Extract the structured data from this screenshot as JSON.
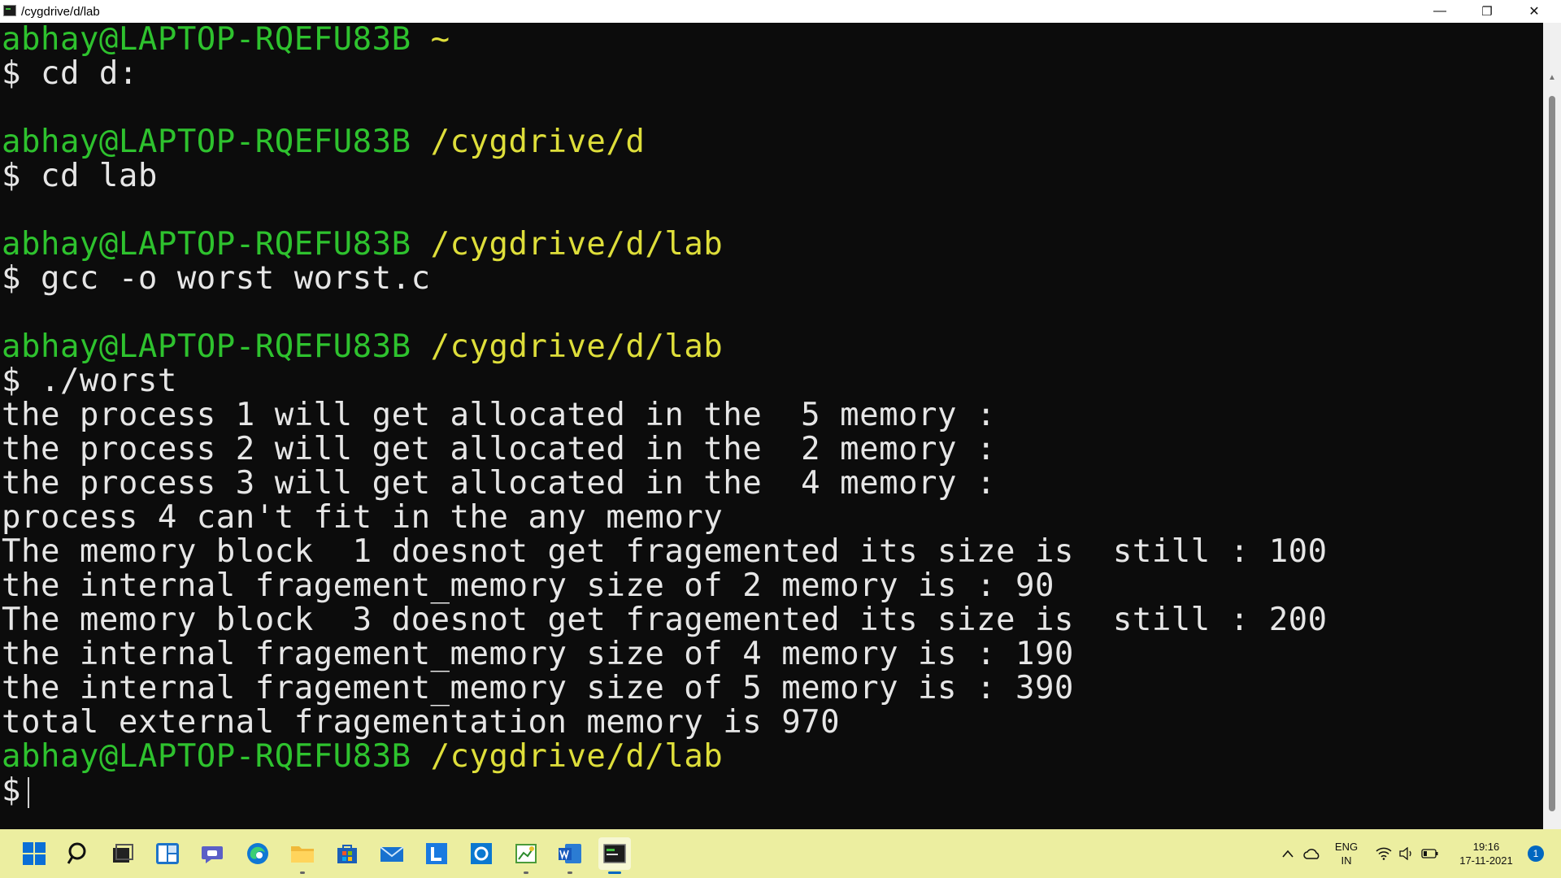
{
  "window": {
    "title": "/cygdrive/d/lab",
    "minimize_glyph": "—",
    "restore_glyph": "❐",
    "close_glyph": "✕"
  },
  "terminal": {
    "colors": {
      "user": "#2ec22e",
      "path": "#dede3a",
      "text": "#e6e6e6",
      "background": "#0c0c0c"
    },
    "lines": [
      {
        "user": "abhay@LAPTOP-RQEFU83B",
        "path": "~",
        "text": ""
      },
      {
        "user": "",
        "path": "",
        "text": "$ cd d:"
      },
      {
        "user": "",
        "path": "",
        "text": ""
      },
      {
        "user": "abhay@LAPTOP-RQEFU83B",
        "path": "/cygdrive/d",
        "text": ""
      },
      {
        "user": "",
        "path": "",
        "text": "$ cd lab"
      },
      {
        "user": "",
        "path": "",
        "text": ""
      },
      {
        "user": "abhay@LAPTOP-RQEFU83B",
        "path": "/cygdrive/d/lab",
        "text": ""
      },
      {
        "user": "",
        "path": "",
        "text": "$ gcc -o worst worst.c"
      },
      {
        "user": "",
        "path": "",
        "text": ""
      },
      {
        "user": "abhay@LAPTOP-RQEFU83B",
        "path": "/cygdrive/d/lab",
        "text": ""
      },
      {
        "user": "",
        "path": "",
        "text": "$ ./worst"
      },
      {
        "user": "",
        "path": "",
        "text": "the process 1 will get allocated in the  5 memory :"
      },
      {
        "user": "",
        "path": "",
        "text": "the process 2 will get allocated in the  2 memory :"
      },
      {
        "user": "",
        "path": "",
        "text": "the process 3 will get allocated in the  4 memory :"
      },
      {
        "user": "",
        "path": "",
        "text": "process 4 can't fit in the any memory"
      },
      {
        "user": "",
        "path": "",
        "text": "The memory block  1 doesnot get fragemented its size is  still : 100"
      },
      {
        "user": "",
        "path": "",
        "text": "the internal fragement_memory size of 2 memory is : 90"
      },
      {
        "user": "",
        "path": "",
        "text": "The memory block  3 doesnot get fragemented its size is  still : 200"
      },
      {
        "user": "",
        "path": "",
        "text": "the internal fragement_memory size of 4 memory is : 190"
      },
      {
        "user": "",
        "path": "",
        "text": "the internal fragement_memory size of 5 memory is : 390"
      },
      {
        "user": "",
        "path": "",
        "text": "total external fragementation memory is 970"
      },
      {
        "user": "abhay@LAPTOP-RQEFU83B",
        "path": "/cygdrive/d/lab",
        "text": ""
      }
    ],
    "current_prompt": "$"
  },
  "taskbar": {
    "background": "#eceea0",
    "apps": [
      {
        "name": "start-icon"
      },
      {
        "name": "search-icon"
      },
      {
        "name": "task-view-icon"
      },
      {
        "name": "widgets-icon"
      },
      {
        "name": "teams-chat-icon"
      },
      {
        "name": "edge-icon"
      },
      {
        "name": "file-explorer-icon"
      },
      {
        "name": "store-icon"
      },
      {
        "name": "mail-icon"
      },
      {
        "name": "l-app-icon"
      },
      {
        "name": "outlook-icon"
      },
      {
        "name": "chart-app-icon"
      },
      {
        "name": "word-icon"
      },
      {
        "name": "terminal-icon"
      }
    ],
    "tray": {
      "language_top": "ENG",
      "language_bottom": "IN",
      "time": "19:16",
      "date": "17-11-2021",
      "notification_count": "1"
    }
  }
}
